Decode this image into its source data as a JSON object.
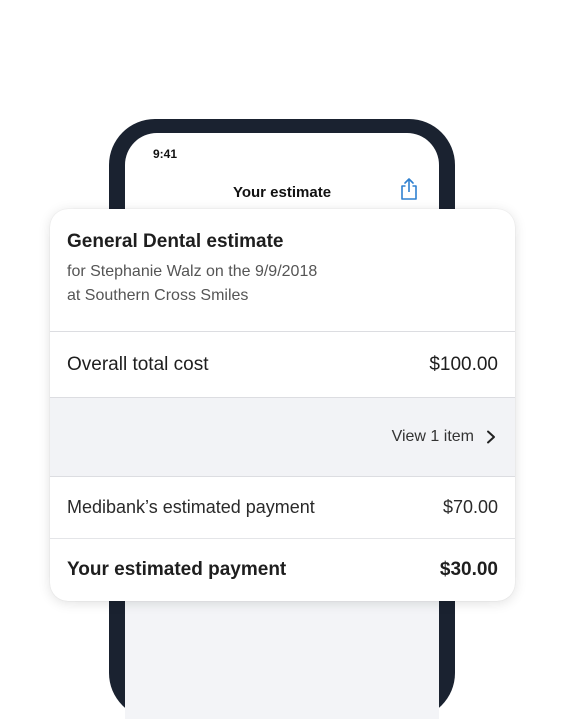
{
  "phone": {
    "status_time": "9:41",
    "nav_title": "Your estimate",
    "share_icon": "share-icon"
  },
  "estimate": {
    "title": "General Dental estimate",
    "subtitle_line1": "for Stephanie Walz on the 9/9/2018",
    "subtitle_line2": "at Southern Cross Smiles",
    "overall_total_label": "Overall total cost",
    "overall_total_value": "$100.00",
    "view_items_label": "View 1 item",
    "medibank_label": "Medibank’s estimated payment",
    "medibank_value": "$70.00",
    "your_label": "Your estimated payment",
    "your_value": "$30.00"
  },
  "colors": {
    "phone_frame": "#1a2230",
    "accent": "#2f80d0",
    "divider": "#dcdde1",
    "row_highlight": "#f2f3f6"
  }
}
